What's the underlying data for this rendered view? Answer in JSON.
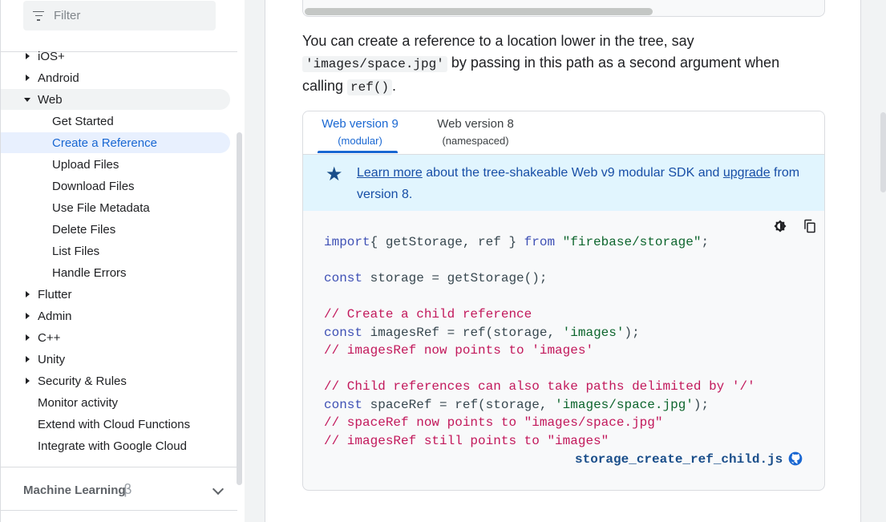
{
  "sidebar": {
    "filter": {
      "placeholder": "Filter"
    },
    "items": [
      {
        "label": "iOS+",
        "level": 1,
        "caret": "right"
      },
      {
        "label": "Android",
        "level": 1,
        "caret": "right"
      },
      {
        "label": "Web",
        "level": 1,
        "caret": "down",
        "state": "expanded"
      },
      {
        "label": "Get Started",
        "level": 2
      },
      {
        "label": "Create a Reference",
        "level": 2,
        "state": "selected"
      },
      {
        "label": "Upload Files",
        "level": 2
      },
      {
        "label": "Download Files",
        "level": 2
      },
      {
        "label": "Use File Metadata",
        "level": 2
      },
      {
        "label": "Delete Files",
        "level": 2
      },
      {
        "label": "List Files",
        "level": 2
      },
      {
        "label": "Handle Errors",
        "level": 2
      },
      {
        "label": "Flutter",
        "level": 1,
        "caret": "right"
      },
      {
        "label": "Admin",
        "level": 1,
        "caret": "right"
      },
      {
        "label": "C++",
        "level": 1,
        "caret": "right"
      },
      {
        "label": "Unity",
        "level": 1,
        "caret": "right"
      },
      {
        "label": "Security & Rules",
        "level": 1,
        "caret": "right"
      },
      {
        "label": "Monitor activity",
        "level": 1
      },
      {
        "label": "Extend with Cloud Functions",
        "level": 1
      },
      {
        "label": "Integrate with Google Cloud",
        "level": 1
      }
    ],
    "section": {
      "label": "Machine Learning",
      "badge": "β"
    }
  },
  "content": {
    "para": {
      "t1": "You can create a reference to a location lower in the tree, say ",
      "c1": "'images/space.jpg'",
      "t2": " by passing in this path as a second argument when calling ",
      "c2": "ref()",
      "t3": "."
    },
    "tabs": [
      {
        "title": "Web version 9",
        "subtitle": "(modular)",
        "active": true
      },
      {
        "title": "Web version 8",
        "subtitle": "(namespaced)",
        "active": false
      }
    ],
    "notice": {
      "link1": "Learn more",
      "mid": " about the tree-shakeable Web v9 modular SDK and ",
      "link2": "upgrade",
      "end": " from version 8."
    },
    "code": {
      "lines": [
        [
          [
            "kw",
            "import"
          ],
          [
            "",
            "{ getStorage, ref } "
          ],
          [
            "kw",
            "from"
          ],
          [
            "",
            ""
          ],
          [
            "str",
            " \"firebase/storage\""
          ],
          [
            "",
            ";"
          ]
        ],
        [],
        [
          [
            "kw",
            "const"
          ],
          [
            "",
            " storage = getStorage();"
          ]
        ],
        [],
        [
          [
            "cm",
            "// Create a child reference"
          ]
        ],
        [
          [
            "kw",
            "const"
          ],
          [
            "",
            " imagesRef = ref(storage, "
          ],
          [
            "str",
            "'images'"
          ],
          [
            "",
            ");"
          ]
        ],
        [
          [
            "cm",
            "// imagesRef now points to 'images'"
          ]
        ],
        [],
        [
          [
            "cm",
            "// Child references can also take paths delimited by '/'"
          ]
        ],
        [
          [
            "kw",
            "const"
          ],
          [
            "",
            " spaceRef = ref(storage, "
          ],
          [
            "str",
            "'images/space.jpg'"
          ],
          [
            "",
            ");"
          ]
        ],
        [
          [
            "cm",
            "// spaceRef now points to \"images/space.jpg\""
          ]
        ],
        [
          [
            "cm",
            "// imagesRef still points to \"images\""
          ]
        ]
      ],
      "source_file": "storage_create_ref_child.js"
    },
    "colors": {
      "link_blue": "#1967d2",
      "notice_bg": "#e1f5fe",
      "selected_bg": "#e8f0fe",
      "keyword": "#3f51b5",
      "string": "#0d652d",
      "comment": "#c2185b"
    }
  }
}
